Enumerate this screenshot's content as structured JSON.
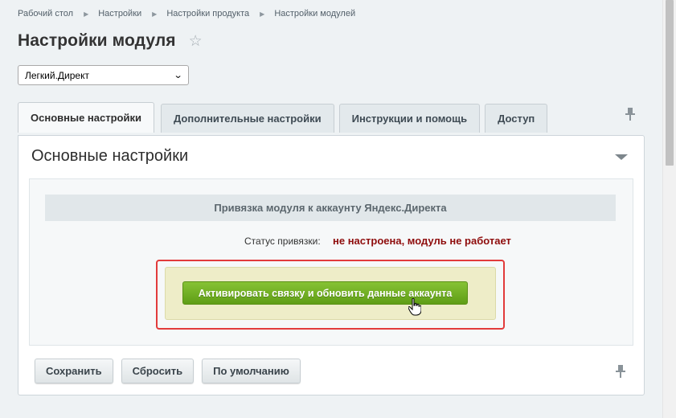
{
  "breadcrumb": [
    "Рабочий стол",
    "Настройки",
    "Настройки продукта",
    "Настройки модулей"
  ],
  "page_title": "Настройки модуля",
  "module_select": {
    "selected": "Легкий.Директ"
  },
  "tabs": [
    {
      "label": "Основные настройки"
    },
    {
      "label": "Дополнительные настройки"
    },
    {
      "label": "Инструкции и помощь"
    },
    {
      "label": "Доступ"
    }
  ],
  "section": {
    "title": "Основные настройки",
    "binding_header": "Привязка модуля к аккаунту Яндекс.Директа",
    "status_label": "Статус привязки:",
    "status_value": "не настроена, модуль не работает",
    "activate_button": "Активировать связку и обновить данные аккаунта"
  },
  "footer": {
    "save": "Сохранить",
    "reset": "Сбросить",
    "default": "По умолчанию"
  },
  "colors": {
    "status_error": "#8e0c0c",
    "activate_button": "#6fae21",
    "highlight_border": "#e23b3b"
  }
}
